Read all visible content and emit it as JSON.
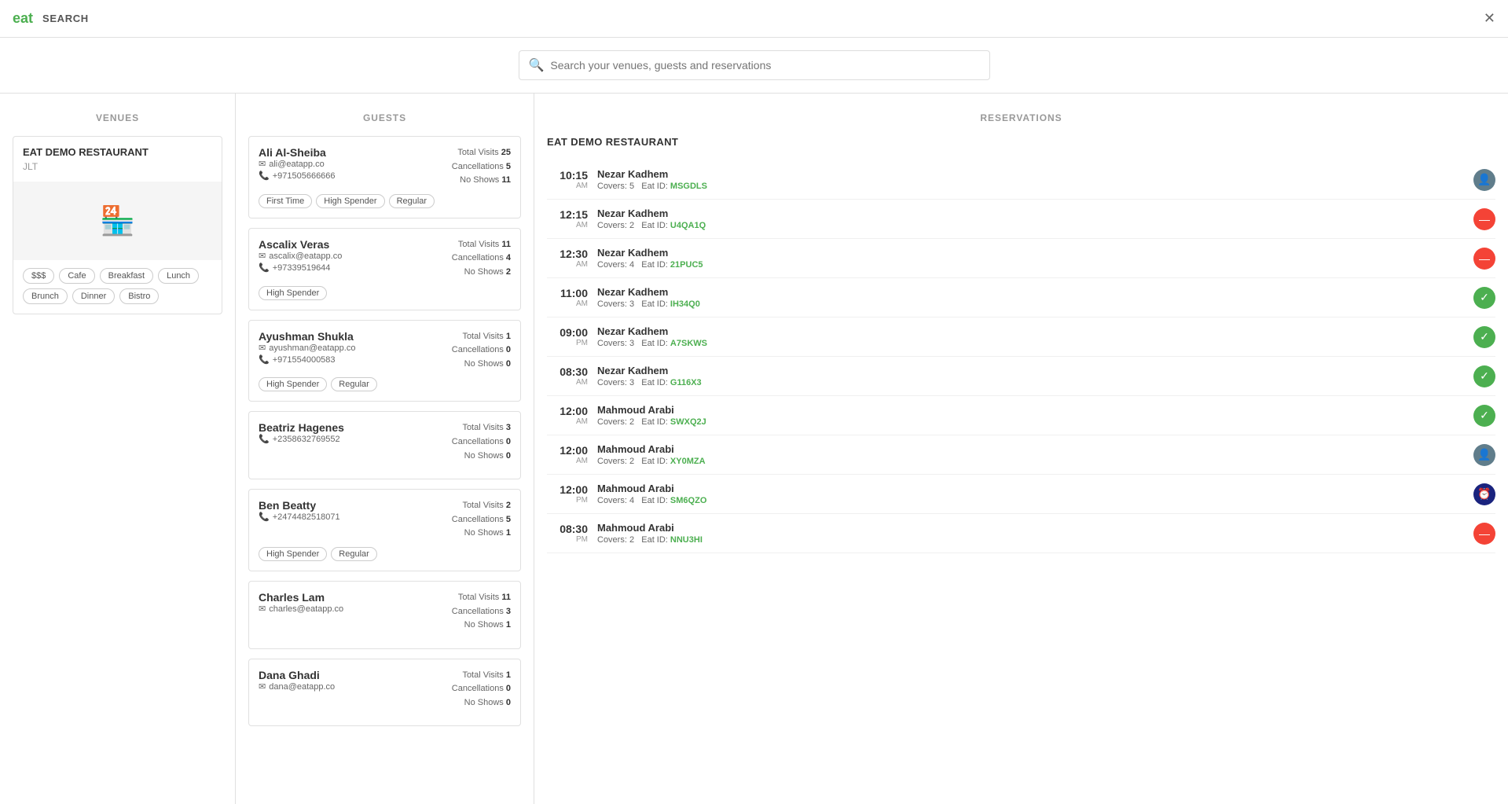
{
  "header": {
    "logo": "eat",
    "label": "SEARCH",
    "close_label": "✕"
  },
  "search": {
    "placeholder": "Search your venues, guests and reservations"
  },
  "venues": {
    "title": "VENUES",
    "venue": {
      "name": "EAT DEMO RESTAURANT",
      "location": "JLT",
      "tags": [
        "$$$",
        "Cafe",
        "Breakfast",
        "Lunch",
        "Brunch",
        "Dinner",
        "Bistro"
      ]
    }
  },
  "guests": {
    "title": "GUESTS",
    "items": [
      {
        "name": "Ali Al-Sheiba",
        "email": "ali@eatapp.co",
        "phone": "+971505666666",
        "total_visits": 25,
        "cancellations": 5,
        "no_shows": 11,
        "badges": [
          "First Time",
          "High Spender",
          "Regular"
        ]
      },
      {
        "name": "Ascalix Veras",
        "email": "ascalix@eatapp.co",
        "phone": "+97339519644",
        "total_visits": 11,
        "cancellations": 4,
        "no_shows": 2,
        "badges": [
          "High Spender"
        ]
      },
      {
        "name": "Ayushman Shukla",
        "email": "ayushman@eatapp.co",
        "phone": "+971554000583",
        "total_visits": 1,
        "cancellations": 0,
        "no_shows": 0,
        "badges": [
          "High Spender",
          "Regular"
        ]
      },
      {
        "name": "Beatriz Hagenes",
        "email": "",
        "phone": "+2358632769552",
        "total_visits": 3,
        "cancellations": 0,
        "no_shows": 0,
        "badges": []
      },
      {
        "name": "Ben Beatty",
        "email": "",
        "phone": "+2474482518071",
        "total_visits": 2,
        "cancellations": 5,
        "no_shows": 1,
        "badges": [
          "High Spender",
          "Regular"
        ]
      },
      {
        "name": "Charles Lam",
        "email": "charles@eatapp.co",
        "phone": "",
        "total_visits": 11,
        "cancellations": 3,
        "no_shows": 1,
        "badges": []
      },
      {
        "name": "Dana Ghadi",
        "email": "dana@eatapp.co",
        "phone": "",
        "total_visits": 1,
        "cancellations": 0,
        "no_shows": 0,
        "badges": []
      }
    ]
  },
  "reservations": {
    "title": "RESERVATIONS",
    "venue_title": "EAT DEMO RESTAURANT",
    "items": [
      {
        "time": "10:15",
        "period": "AM",
        "name": "Nezar Kadhem",
        "covers": 5,
        "eat_id": "MSGDLS",
        "status": "noshow"
      },
      {
        "time": "12:15",
        "period": "AM",
        "name": "Nezar Kadhem",
        "covers": 2,
        "eat_id": "U4QA1Q",
        "status": "cancelled"
      },
      {
        "time": "12:30",
        "period": "AM",
        "name": "Nezar Kadhem",
        "covers": 4,
        "eat_id": "21PUC5",
        "status": "cancelled"
      },
      {
        "time": "11:00",
        "period": "AM",
        "name": "Nezar Kadhem",
        "covers": 3,
        "eat_id": "IH34Q0",
        "status": "confirmed"
      },
      {
        "time": "09:00",
        "period": "PM",
        "name": "Nezar Kadhem",
        "covers": 3,
        "eat_id": "A7SKWS",
        "status": "confirmed"
      },
      {
        "time": "08:30",
        "period": "AM",
        "name": "Nezar Kadhem",
        "covers": 3,
        "eat_id": "G116X3",
        "status": "confirmed"
      },
      {
        "time": "12:00",
        "period": "AM",
        "name": "Mahmoud Arabi",
        "covers": 2,
        "eat_id": "SWXQ2J",
        "status": "confirmed"
      },
      {
        "time": "12:00",
        "period": "AM",
        "name": "Mahmoud Arabi",
        "covers": 2,
        "eat_id": "XY0MZA",
        "status": "noshow"
      },
      {
        "time": "12:00",
        "period": "PM",
        "name": "Mahmoud Arabi",
        "covers": 4,
        "eat_id": "SM6QZO",
        "status": "waitlist"
      },
      {
        "time": "08:30",
        "period": "PM",
        "name": "Mahmoud Arabi",
        "covers": 2,
        "eat_id": "NNU3HI",
        "status": "cancelled"
      }
    ],
    "labels": {
      "covers": "Covers:",
      "eat_id": "Eat ID:"
    }
  }
}
